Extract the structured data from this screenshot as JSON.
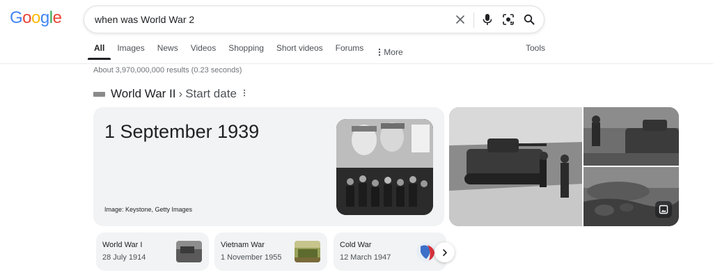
{
  "logo": {
    "letters": [
      "G",
      "o",
      "o",
      "g",
      "l",
      "e"
    ]
  },
  "search": {
    "query": "when was World War 2"
  },
  "icons": {
    "clear": "close-icon",
    "mic": "microphone-icon",
    "lens": "camera-lens-icon",
    "search": "search-icon",
    "more": "vertical-dots-icon",
    "gallery": "image-gallery-icon",
    "next": "chevron-right-icon"
  },
  "tabs": [
    {
      "label": "All",
      "active": true
    },
    {
      "label": "Images"
    },
    {
      "label": "News"
    },
    {
      "label": "Videos"
    },
    {
      "label": "Shopping"
    },
    {
      "label": "Short videos"
    },
    {
      "label": "Forums"
    },
    {
      "label": "More"
    }
  ],
  "tools_label": "Tools",
  "result_stats": "About 3,970,000,000 results (0.23 seconds)",
  "knowledge": {
    "title": "World War II",
    "separator": "›",
    "attribute": "Start date",
    "answer": "1 September 1939",
    "image_credit": "Image: Keystone, Getty Images"
  },
  "related": [
    {
      "title": "World War I",
      "date": "28 July 1914"
    },
    {
      "title": "Vietnam War",
      "date": "1 November 1955"
    },
    {
      "title": "Cold War",
      "date": "12 March 1947"
    }
  ],
  "colors": {
    "google_blue": "#4285f4",
    "google_red": "#ea4335",
    "google_yellow": "#fbbc05",
    "google_green": "#34a853",
    "card_bg": "#f1f3f4"
  }
}
